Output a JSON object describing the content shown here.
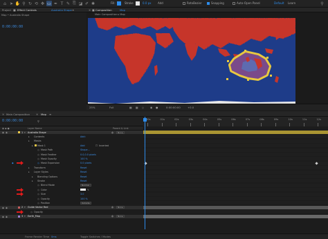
{
  "toolbar": {
    "stroke_label": "Stroke",
    "stroke_width": "0.0 px",
    "add_label": "Add",
    "rotobezier_label": "RotoBezier",
    "snapping_label": "Snapping",
    "auto_open_label": "Auto-Open Panel",
    "workspace_default": "Default",
    "workspace_learn": "Learn",
    "colors": {
      "fill_swatch": "#2d8ceb",
      "stroke_swatch": "#e6e6e6"
    }
  },
  "left_panel": {
    "tab_project": "Project",
    "tab_effect_controls": "Effect Controls",
    "effect_target": "Australia Shape",
    "subtitle": "Map • Australia Shape",
    "time": "0:00:00:00"
  },
  "viewer": {
    "tab_label": "Composition",
    "tab_comp": "Map",
    "breadcrumb": "Main Composition ▸ Map",
    "zoom": "25%",
    "resolution": "Full",
    "time": "0:00:00:00",
    "exposure": "+0.0"
  },
  "timeline": {
    "tabs": [
      "Main Composition",
      "Map"
    ],
    "time": "0:00:00:00",
    "ruler_labels": [
      "00s",
      "01s",
      "02s",
      "03s",
      "04s",
      "05s",
      "06s",
      "07s",
      "08s",
      "09s",
      "10s",
      "11s",
      "12s"
    ],
    "columns": {
      "layer_name": "Layer Name",
      "parent": "Parent & Link",
      "mode": "Mode"
    },
    "rows": [
      {
        "name": "Australia Shape",
        "type": "layer",
        "indent": 0,
        "num": "1",
        "color": "#e8c84a",
        "parent": "None"
      },
      {
        "name": "Contents",
        "type": "group",
        "indent": 1,
        "value": "Add:"
      },
      {
        "name": "Masks",
        "type": "group",
        "indent": 1
      },
      {
        "name": "Mask 1",
        "type": "group",
        "indent": 2,
        "value": "Add",
        "extra": "Inverted",
        "color": "#e8c84a"
      },
      {
        "name": "Mask Path",
        "type": "prop",
        "indent": 3,
        "value": "Shape..."
      },
      {
        "name": "Mask Feather",
        "type": "prop",
        "indent": 3,
        "value": "0.0,0.0 pixels"
      },
      {
        "name": "Mask Opacity",
        "type": "prop",
        "indent": 3,
        "value": "100 %"
      },
      {
        "name": "Mask Expansion",
        "type": "prop",
        "indent": 3,
        "value": "0.0 pixels",
        "keyframed": true,
        "arrow": true
      },
      {
        "name": "Transform",
        "type": "group",
        "indent": 1,
        "value": "Reset"
      },
      {
        "name": "Layer Styles",
        "type": "group",
        "indent": 1,
        "value": "Reset"
      },
      {
        "name": "Blending Options",
        "type": "group",
        "indent": 2,
        "value": "Reset"
      },
      {
        "name": "Stroke",
        "type": "group",
        "indent": 2,
        "value": "Reset"
      },
      {
        "name": "Blend Mode",
        "type": "prop",
        "indent": 3,
        "value": "Normal",
        "dropdown": true
      },
      {
        "name": "Color",
        "type": "prop",
        "indent": 3,
        "value": "",
        "swatch": "#ffffff",
        "arrow": true
      },
      {
        "name": "Size",
        "type": "prop",
        "indent": 3,
        "value": "3.0",
        "arrow": true
      },
      {
        "name": "Opacity",
        "type": "prop",
        "indent": 3,
        "value": "100 %"
      },
      {
        "name": "Position",
        "type": "prop",
        "indent": 3,
        "value": "Outside",
        "dropdown": true
      },
      {
        "name": "Guide Vector Red",
        "type": "layer",
        "indent": 0,
        "num": "2",
        "color": "#c35b5b",
        "parent": "None"
      },
      {
        "name": "Opacity",
        "type": "prop",
        "indent": 1,
        "value": "",
        "arrow": true
      },
      {
        "name": "Earth_Map",
        "type": "layer",
        "indent": 0,
        "num": "3",
        "color": "#9b7ed0",
        "parent": "None"
      }
    ]
  },
  "status": {
    "frame_render_label": "Frame Render Time",
    "frame_render_value": "0ms",
    "toggle_label": "Toggle Switches / Modes"
  }
}
